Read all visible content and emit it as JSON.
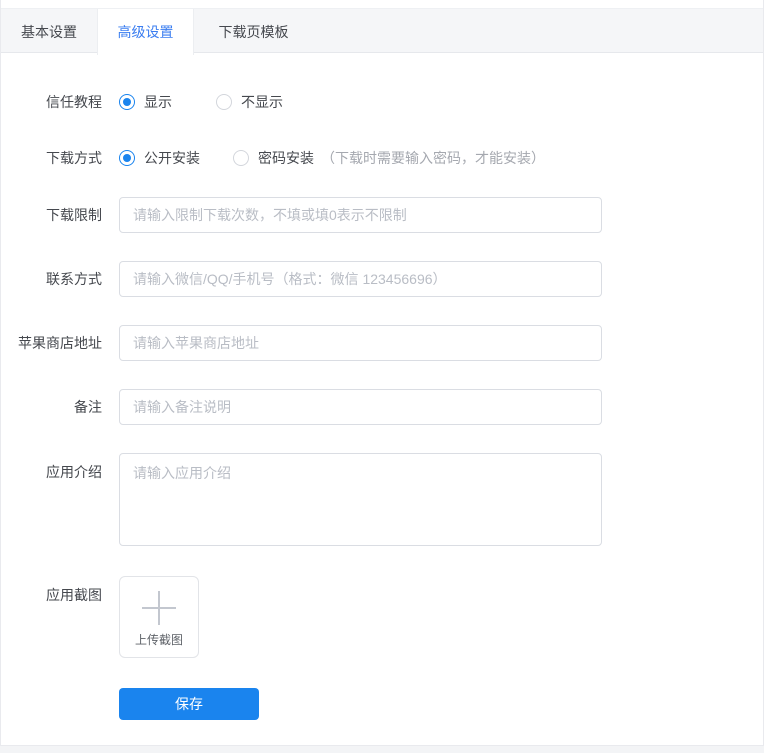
{
  "colors": {
    "accent": "#1a84ee",
    "tab_active_text": "#3a7df0"
  },
  "tabs": [
    {
      "label": "基本设置",
      "active": false
    },
    {
      "label": "高级设置",
      "active": true
    },
    {
      "label": "下载页模板",
      "active": false
    }
  ],
  "form": {
    "trust": {
      "label": "信任教程",
      "options": [
        {
          "label": "显示",
          "selected": true
        },
        {
          "label": "不显示",
          "selected": false
        }
      ]
    },
    "method": {
      "label": "下载方式",
      "options": [
        {
          "label": "公开安装",
          "selected": true
        },
        {
          "label": "密码安装",
          "selected": false
        }
      ],
      "note": "（下载时需要输入密码，才能安装）"
    },
    "limit": {
      "label": "下载限制",
      "value": "",
      "placeholder": "请输入限制下载次数，不填或填0表示不限制"
    },
    "contact": {
      "label": "联系方式",
      "value": "",
      "placeholder": "请输入微信/QQ/手机号（格式：微信 123456696）"
    },
    "appstore": {
      "label": "苹果商店地址",
      "value": "",
      "placeholder": "请输入苹果商店地址"
    },
    "remark": {
      "label": "备注",
      "value": "",
      "placeholder": "请输入备注说明"
    },
    "intro": {
      "label": "应用介绍",
      "value": "",
      "placeholder": "请输入应用介绍"
    },
    "screenshot": {
      "label": "应用截图",
      "upload_text": "上传截图"
    },
    "save_label": "保存"
  },
  "icons": {
    "plus": "+"
  }
}
